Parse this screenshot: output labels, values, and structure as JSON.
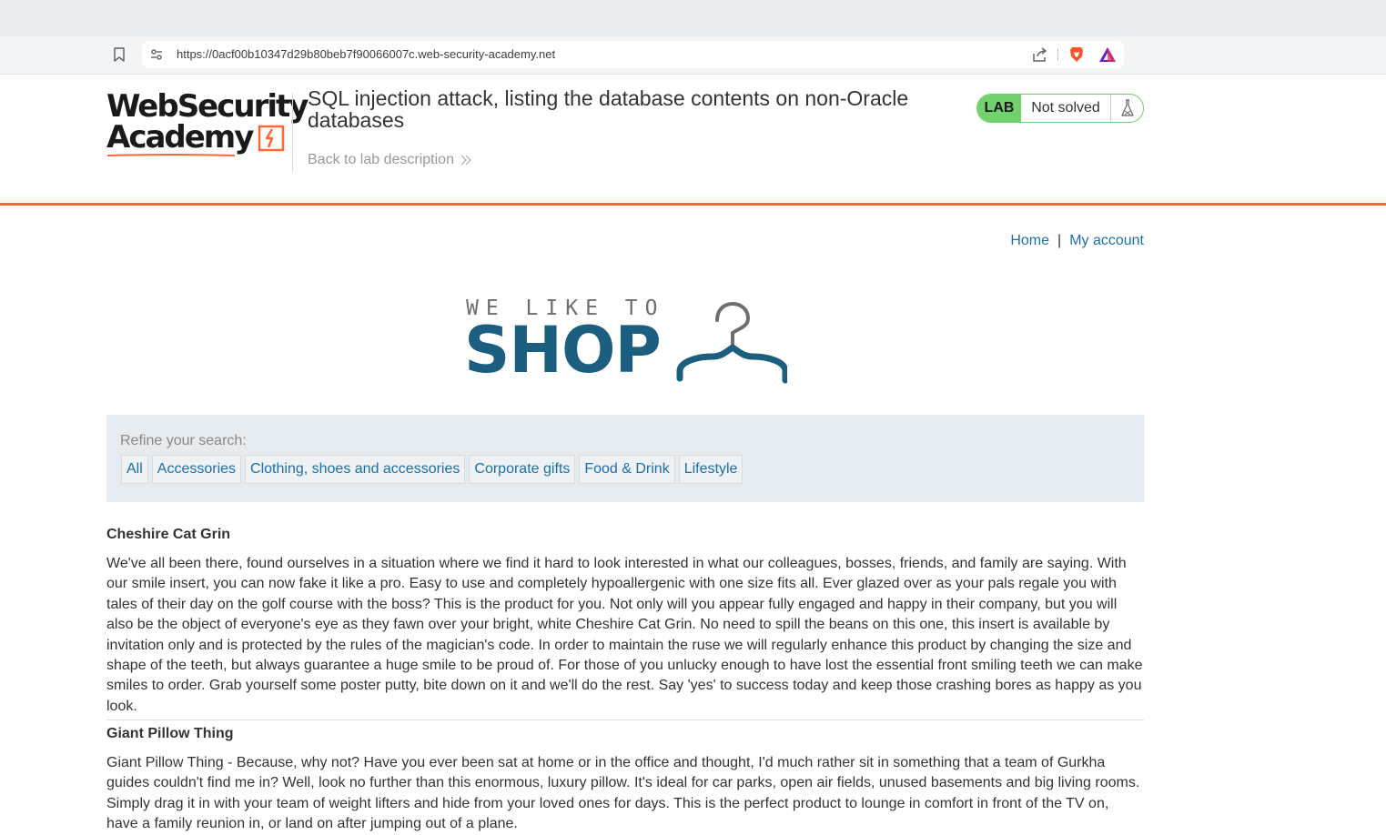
{
  "browser": {
    "url": "https://0acf00b10347d29b80beb7f90066007c.web-security-academy.net"
  },
  "academy": {
    "logo_line1": "WebSecurity",
    "logo_line2": "Academy",
    "lab_title": "SQL injection attack, listing the database contents on non-Oracle databases",
    "back_link": "Back to lab description",
    "lab_badge": "LAB",
    "lab_status": "Not solved"
  },
  "nav": {
    "home": "Home",
    "separator": "|",
    "my_account": "My account"
  },
  "shop_logo": {
    "tagline": "WE LIKE TO",
    "word": "SHOP"
  },
  "filters": {
    "label": "Refine your search:",
    "items": [
      "All",
      "Accessories",
      "Clothing, shoes and accessories",
      "Corporate gifts",
      "Food & Drink",
      "Lifestyle"
    ]
  },
  "products": [
    {
      "name": "Cheshire Cat Grin",
      "description": "We've all been there, found ourselves in a situation where we find it hard to look interested in what our colleagues, bosses, friends, and family are saying. With our smile insert, you can now fake it like a pro. Easy to use and completely hypoallergenic with one size fits all. Ever glazed over as your pals regale you with tales of their day on the golf course with the boss? This is the product for you. Not only will you appear fully engaged and happy in their company, but you will also be the object of everyone's eye as they fawn over your bright, white Cheshire Cat Grin. No need to spill the beans on this one, this insert is available by invitation only and is protected by the rules of the magician's code. In order to maintain the ruse we will regularly enhance this product by changing the size and shape of the teeth, but always guarantee a huge smile to be proud of. For those of you unlucky enough to have lost the essential front smiling teeth we can make smiles to order. Grab yourself some poster putty, bite down on it and we'll do the rest. Say 'yes' to success today and keep those crashing bores as happy as you look."
    },
    {
      "name": "Giant Pillow Thing",
      "description": "Giant Pillow Thing - Because, why not? Have you ever been sat at home or in the office and thought, I'd much rather sit in something that a team of Gurkha guides couldn't find me in? Well, look no further than this enormous, luxury pillow. It's ideal for car parks, open air fields, unused basements and big living rooms. Simply drag it in with your team of weight lifters and hide from your loved ones for days. This is the perfect product to lounge in comfort in front of the TV on, have a family reunion in, or land on after jumping out of a plane."
    }
  ],
  "colors": {
    "accent_orange": "#ff6633",
    "lab_green": "#70d16d",
    "link_blue": "#1d6fa8",
    "shop_blue": "#1b5e80"
  }
}
